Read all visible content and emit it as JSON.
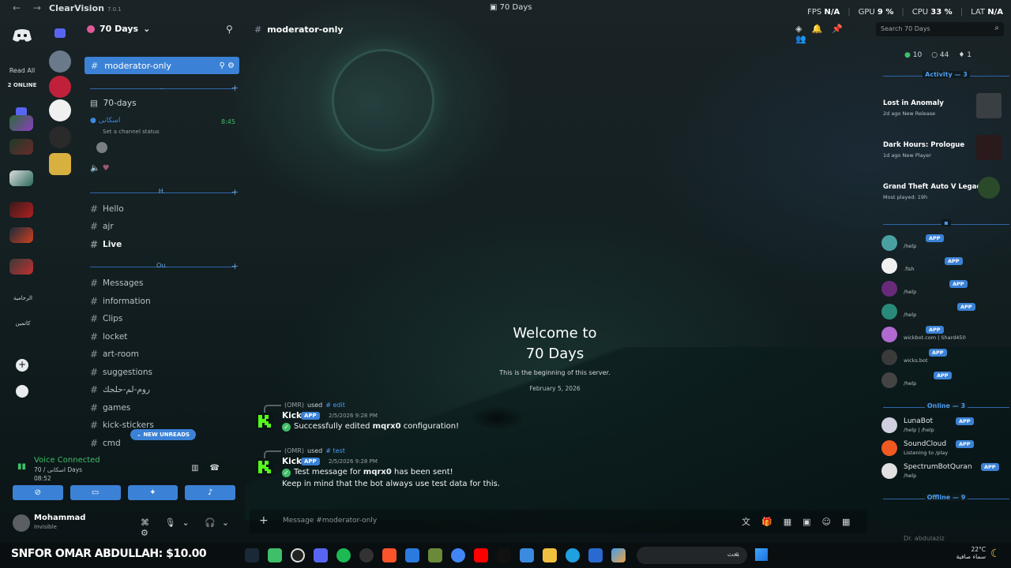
{
  "titlebar": {
    "app_name": "ClearVision",
    "version": "7.0.1",
    "window_title": "70 Days",
    "fps_label": "FPS",
    "fps_value": "N/A",
    "gpu_label": "GPU",
    "gpu_value": "9 %",
    "cpu_label": "CPU",
    "cpu_value": "33 %",
    "lat_label": "LAT",
    "lat_value": "N/A"
  },
  "rail": {
    "read_all": "Read All",
    "online": "2 ONLINE",
    "arabic_1": "الرخامية",
    "arabic_2": "كاتمين"
  },
  "guild": {
    "name": "70 Days"
  },
  "sidebar": {
    "active_channel": "moderator-only",
    "forum_channel": "70-days",
    "voice_user": "اسكانى",
    "voice_status": "Set a channel status",
    "voice_time": "8:45",
    "category_1": "..",
    "category_2": "H.",
    "category_3": "Ou.",
    "channels_h": [
      "Hello",
      "ajr",
      "Live"
    ],
    "channels_ou": [
      "Messages",
      "information",
      "Clips",
      "locket",
      "art-room",
      "suggestions",
      "روم-لم-حلجك",
      "games",
      "kick-stickers",
      "cmd"
    ],
    "new_unreads": "NEW UNREADS"
  },
  "voice": {
    "title": "Voice Connected",
    "subtitle": "70 / اسكانى Days",
    "time": "08:52"
  },
  "user": {
    "name": "Mohammad",
    "status": "Invisible"
  },
  "header": {
    "channel": "moderator-only",
    "search_placeholder": "Search 70 Days"
  },
  "welcome": {
    "line1": "Welcome to",
    "line2": "70 Days",
    "subtitle": "This is the beginning of this server.",
    "date": "February 5, 2026"
  },
  "messages": [
    {
      "reply_user": "(OMR)",
      "used": "used",
      "command": "# edit",
      "author": "Kick",
      "badge": "APP",
      "timestamp": "2/5/2026 9:28 PM",
      "body_pre": "Successfully edited ",
      "body_bold": "mqrx0",
      "body_post": " configuration!"
    },
    {
      "reply_user": "(OMR)",
      "used": "used",
      "command": "# test",
      "author": "Kick",
      "badge": "APP",
      "timestamp": "2/5/2026 9:28 PM",
      "body_pre": "Test message for ",
      "body_bold": "mqrx0",
      "body_post": " has been sent!",
      "body_line2": "Keep in mind that the bot always use test data for this."
    }
  ],
  "composer": {
    "placeholder": "Message #moderator-only"
  },
  "right": {
    "online_count": "10",
    "total_count": "44",
    "boost_count": "1",
    "activity_header": "Activity — 3",
    "activities": [
      {
        "title": "Lost in Anomaly",
        "sub": "2d ago  New Release"
      },
      {
        "title": "Dark Hours: Prologue",
        "sub": "1d ago  New Player"
      },
      {
        "title": "Grand Theft Auto V Legacy",
        "sub": "Most played: 19h"
      }
    ],
    "bots": [
      {
        "name": "",
        "status": "/help",
        "badge": "APP"
      },
      {
        "name": "",
        "status": ".fish",
        "badge": "APP"
      },
      {
        "name": "",
        "status": "/help",
        "badge": "APP"
      },
      {
        "name": "",
        "status": "/help",
        "badge": "APP"
      },
      {
        "name": "",
        "status": "wickbot.com | Shard450",
        "badge": "APP"
      },
      {
        "name": "",
        "status": "wicks.bot",
        "badge": "APP"
      },
      {
        "name": "",
        "status": "/help",
        "badge": "APP"
      }
    ],
    "online_header": "Online — 3",
    "online_members": [
      {
        "name": "LunaBot",
        "status": "/help | /help",
        "badge": "APP"
      },
      {
        "name": "SoundCloud",
        "status": "Listening to /play",
        "badge": "APP"
      },
      {
        "name": "SpectrumBotQuran",
        "status": "/help",
        "badge": "APP"
      }
    ],
    "offline_header": "Offline — 9",
    "offline_preview": "Dr. abdulaziz"
  },
  "taskbar": {
    "ticker": "SNFOR OMAR ABDULLAH: $10.00",
    "search": "بحث",
    "temp": "22°C",
    "weather": "سماء صافية"
  },
  "colors": {
    "accent": "#3b82d6",
    "online": "#3fbf6a",
    "link": "#4b9ef0"
  }
}
